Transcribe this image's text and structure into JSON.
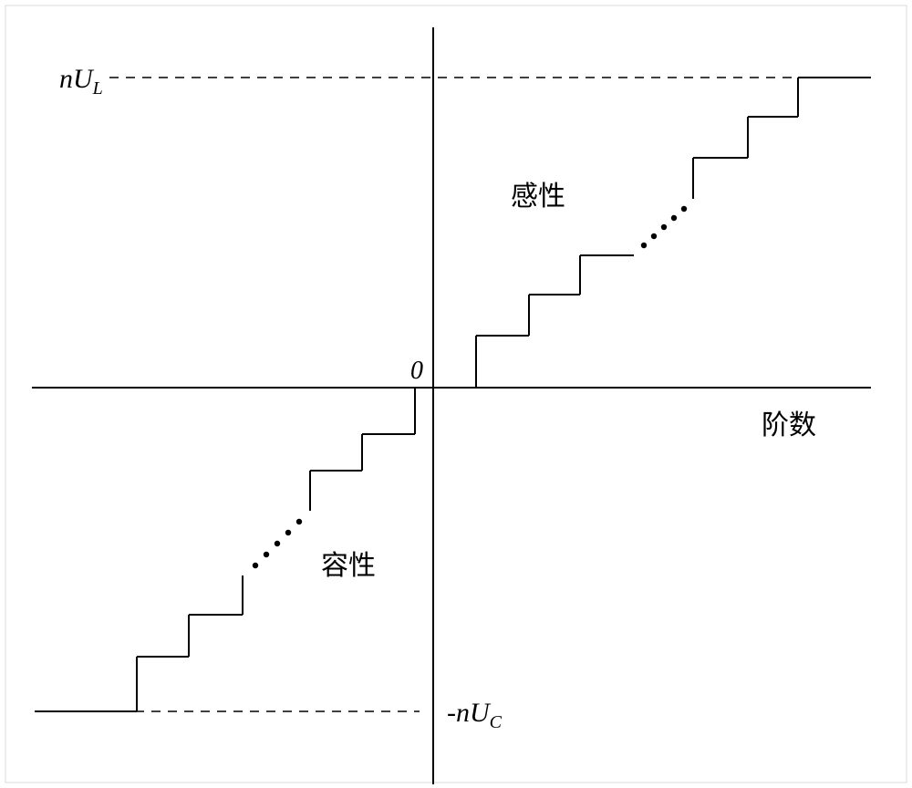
{
  "labels": {
    "y_top": "nU",
    "y_top_sub": "L",
    "y_bottom": "-nU",
    "y_bottom_sub": "C",
    "origin": "0",
    "label_inductive": "感性",
    "label_capacitive": "容性",
    "x_axis": "阶数"
  },
  "chart_data": {
    "type": "diagram-step",
    "axes": {
      "origin": [
        475,
        425
      ],
      "x_range": [
        35,
        955
      ],
      "y_range": [
        30,
        860
      ]
    },
    "top_dashed_y": 85,
    "top_dashed_x_range": [
      120,
      955
    ],
    "bottom_dashed_y": 780,
    "bottom_dashed_x_range": [
      40,
      460
    ],
    "quadrant1": {
      "lower_steps": [
        {
          "x1": 522,
          "y1": 425,
          "x2": 522,
          "y2": 368
        },
        {
          "x1": 522,
          "y1": 368,
          "x2": 580,
          "y2": 368
        },
        {
          "x1": 580,
          "y1": 368,
          "x2": 580,
          "y2": 323
        },
        {
          "x1": 580,
          "y1": 323,
          "x2": 636,
          "y2": 323
        },
        {
          "x1": 636,
          "y1": 323,
          "x2": 636,
          "y2": 280
        },
        {
          "x1": 636,
          "y1": 280,
          "x2": 695,
          "y2": 280
        }
      ],
      "gap_dots": {
        "start": [
          695,
          280
        ],
        "end": [
          760,
          218
        ]
      },
      "upper_steps": [
        {
          "x1": 760,
          "y1": 218,
          "x2": 760,
          "y2": 173
        },
        {
          "x1": 760,
          "y1": 173,
          "x2": 820,
          "y2": 173
        },
        {
          "x1": 820,
          "y1": 173,
          "x2": 820,
          "y2": 128
        },
        {
          "x1": 820,
          "y1": 128,
          "x2": 875,
          "y2": 128
        },
        {
          "x1": 875,
          "y1": 128,
          "x2": 875,
          "y2": 85
        },
        {
          "x1": 875,
          "y1": 85,
          "x2": 955,
          "y2": 85
        }
      ]
    },
    "quadrant3": {
      "upper_steps": [
        {
          "x1": 455,
          "y1": 425,
          "x2": 455,
          "y2": 476
        },
        {
          "x1": 455,
          "y1": 476,
          "x2": 397,
          "y2": 476
        },
        {
          "x1": 397,
          "y1": 476,
          "x2": 397,
          "y2": 516
        },
        {
          "x1": 397,
          "y1": 516,
          "x2": 340,
          "y2": 516
        },
        {
          "x1": 340,
          "y1": 516,
          "x2": 340,
          "y2": 560
        }
      ],
      "gap_dots": {
        "start": [
          340,
          560
        ],
        "end": [
          266,
          631
        ]
      },
      "lower_steps": [
        {
          "x1": 266,
          "y1": 631,
          "x2": 266,
          "y2": 674
        },
        {
          "x1": 266,
          "y1": 674,
          "x2": 207,
          "y2": 674
        },
        {
          "x1": 207,
          "y1": 674,
          "x2": 207,
          "y2": 720
        },
        {
          "x1": 207,
          "y1": 720,
          "x2": 150,
          "y2": 720
        },
        {
          "x1": 150,
          "y1": 720,
          "x2": 150,
          "y2": 780
        },
        {
          "x1": 150,
          "y1": 780,
          "x2": 38,
          "y2": 780
        }
      ]
    }
  }
}
